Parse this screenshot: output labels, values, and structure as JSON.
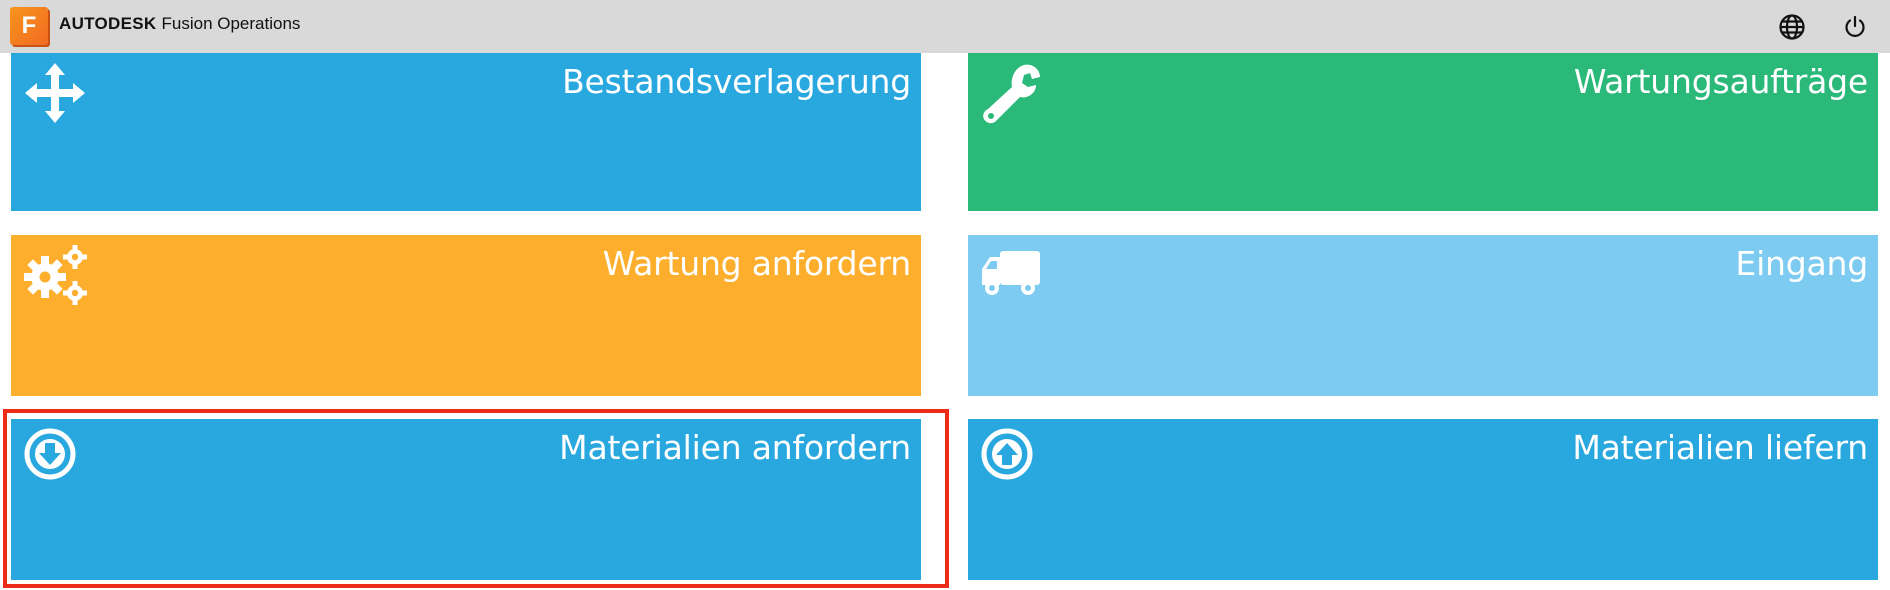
{
  "app": {
    "logo_letter": "F",
    "company": "AUTODESK",
    "product": "Fusion Operations"
  },
  "header_icons": [
    "globe-icon",
    "power-icon"
  ],
  "tiles": [
    {
      "label": "Bestandsverlagerung",
      "color": "#29a8e0",
      "icon": "move-arrows-icon"
    },
    {
      "label": "Wartungsaufträge",
      "color": "#2bb97a",
      "icon": "wrench-icon"
    },
    {
      "label": "Wartung anfordern",
      "color": "#fdae2d",
      "icon": "gears-icon"
    },
    {
      "label": "Eingang",
      "color": "#7dcbf0",
      "icon": "truck-icon"
    },
    {
      "label": "Materialien anfordern",
      "color": "#29a8e0",
      "icon": "arrow-down-circle-icon"
    },
    {
      "label": "Materialien liefern",
      "color": "#29a8e0",
      "icon": "arrow-up-circle-icon"
    }
  ],
  "highlight_color": "#ee2b1b"
}
